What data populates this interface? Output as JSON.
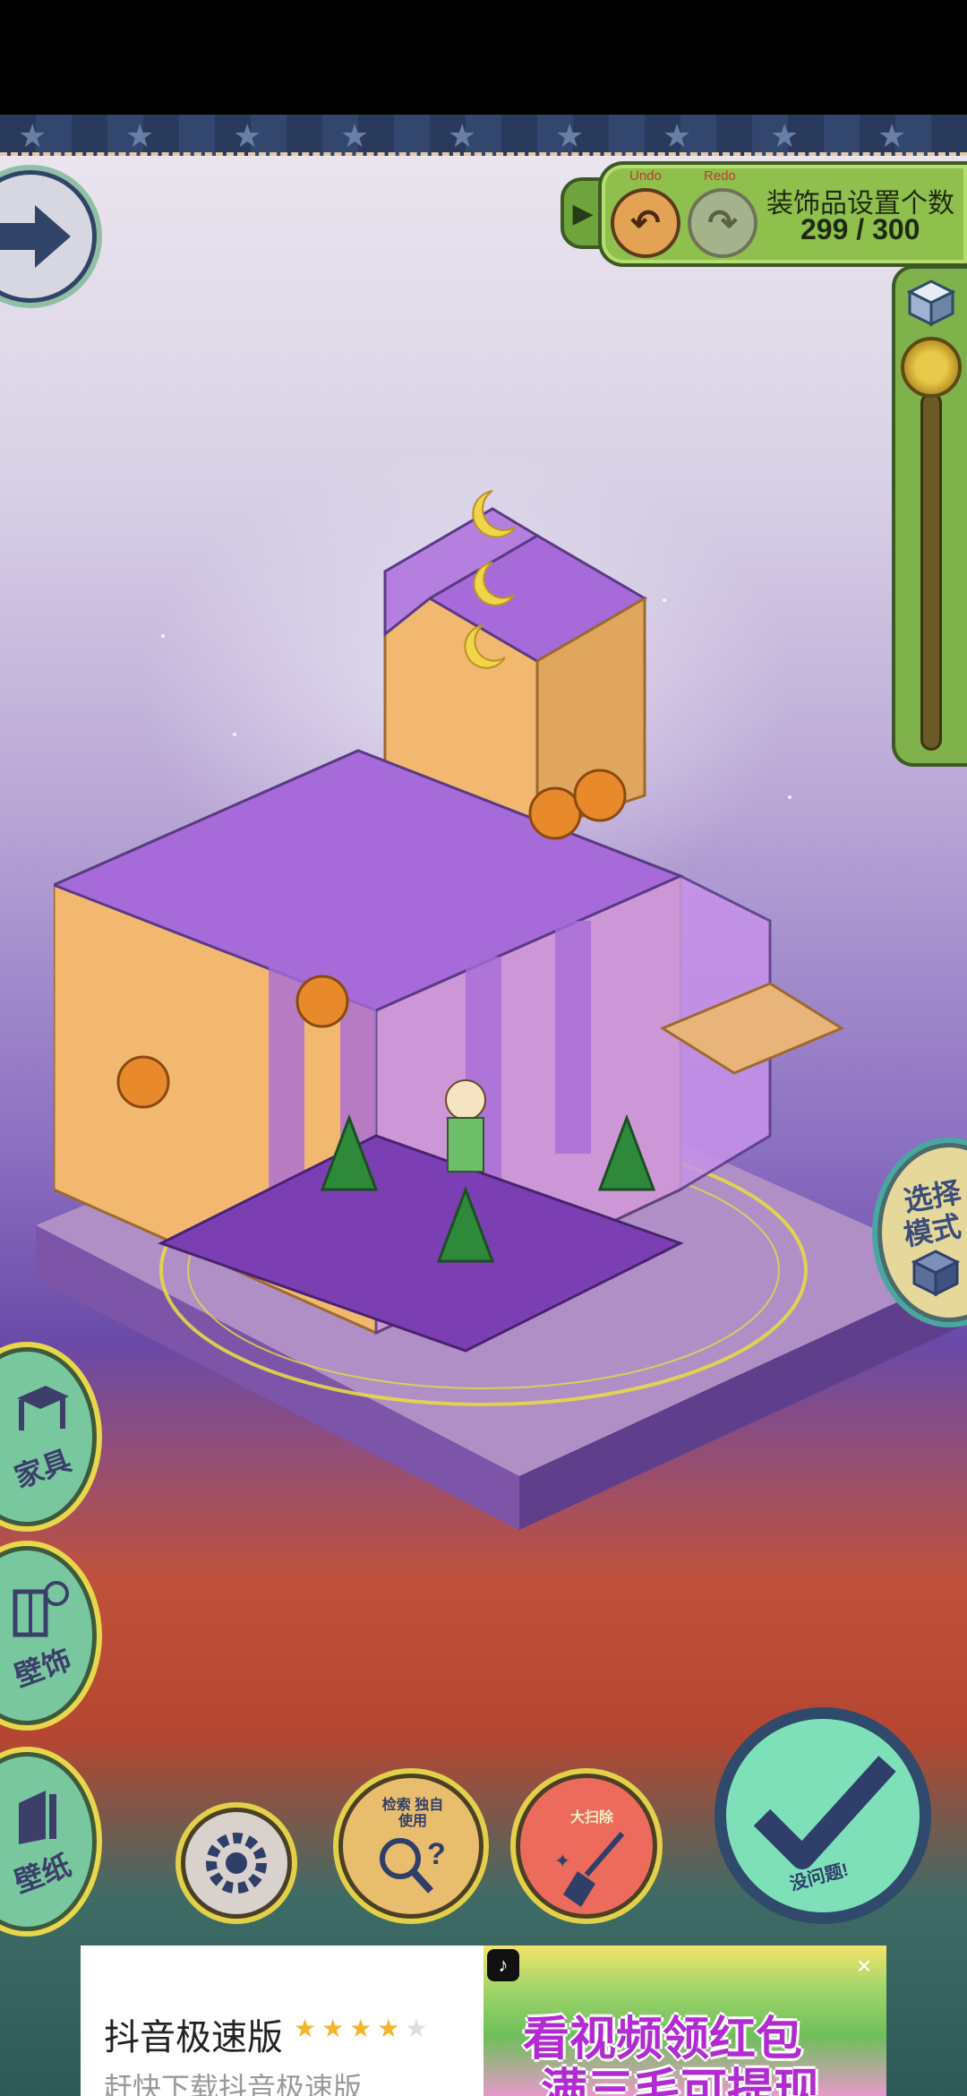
{
  "toolbar": {
    "undo_label": "Undo",
    "redo_label": "Redo",
    "decoration_title": "装饰品设置个数",
    "decoration_count": "299 / 300"
  },
  "side_buttons": {
    "furniture": "家具",
    "wall_decor": "壁饰",
    "wallpaper": "壁纸",
    "select_mode_1": "选择",
    "select_mode_2": "模式"
  },
  "bottom_buttons": {
    "search_label": "检索 独自使用",
    "clean_label": "大扫除",
    "ok_label": "没问题!"
  },
  "ad": {
    "app_name": "抖音极速版",
    "stars_on": "★★★★",
    "stars_off": "★",
    "subtitle": "赶快下载抖音极速版",
    "headline_1": "看视频领红包",
    "headline_2": "满三毛可提现",
    "close": "×"
  },
  "colors": {
    "accent_green": "#8fbf4d",
    "house_orange": "#f2b86f",
    "house_purple": "#a66bd8",
    "ok_button": "#7ee0b9",
    "ad_headline": "#b12bd1"
  }
}
